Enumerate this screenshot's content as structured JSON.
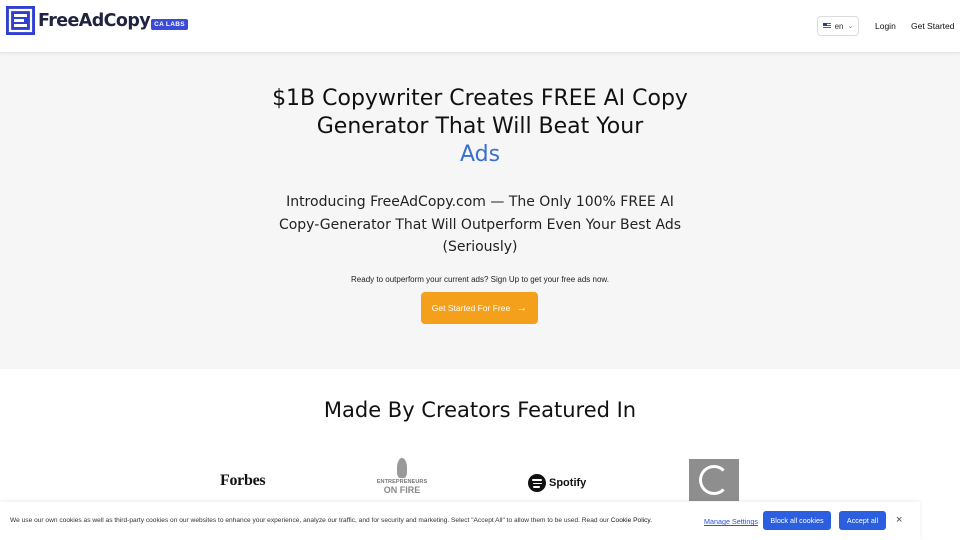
{
  "header": {
    "logo_text": "FreeAdCopy",
    "logo_badge": "CA LABS",
    "lang": "en",
    "nav": {
      "login": "Login",
      "get_started": "Get Started"
    }
  },
  "hero": {
    "title_line1": "$1B Copywriter Creates FREE AI Copy",
    "title_line2": "Generator That Will Beat Your",
    "title_accent": "Ads",
    "subtitle": "Introducing FreeAdCopy.com — The Only 100% FREE AI Copy-Generator That Will Outperform Even Your Best Ads (Seriously)",
    "note": "Ready to outperform your current ads? Sign Up to get your free ads now.",
    "cta_label": "Get Started For Free"
  },
  "featured": {
    "title": "Made By Creators Featured In",
    "brands": {
      "forbes": "Forbes",
      "eof_line1": "ENTREPRENEURS",
      "eof_line2": "ON FIRE",
      "spotify": "Spotify"
    }
  },
  "cookie": {
    "text": "We use our own cookies as well as third-party cookies on our websites to enhance your experience, analyze our traffic, and for security and marketing. Select \"Accept All\" to allow them to be used. Read our ",
    "policy_link": "Cookie Policy",
    "manage": "Manage Settings",
    "block": "Block all cookies",
    "accept": "Accept all",
    "close": "×"
  },
  "colors": {
    "accent": "#3a6fd1",
    "cta": "#f5a01a",
    "cookie_button": "#2c5fe0",
    "logo_badge": "#3b4bd8"
  }
}
